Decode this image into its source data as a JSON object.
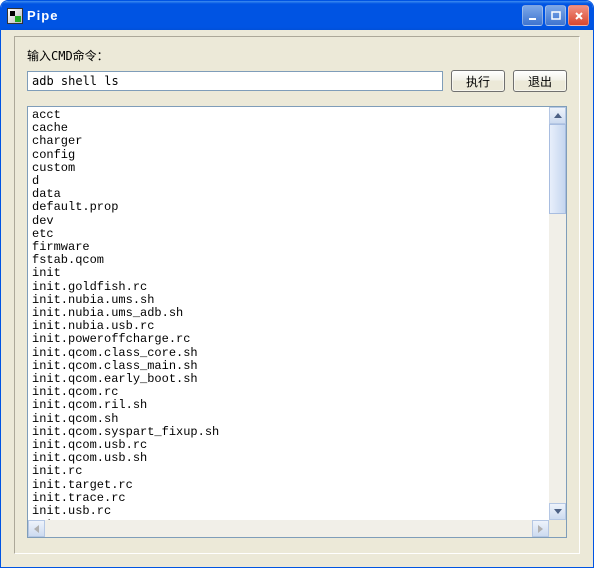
{
  "window": {
    "title": "Pipe"
  },
  "form": {
    "label": "输入CMD命令：",
    "command_value": "adb shell ls",
    "execute_label": "执行",
    "exit_label": "退出"
  },
  "output_lines": [
    "acct",
    "cache",
    "charger",
    "config",
    "custom",
    "d",
    "data",
    "default.prop",
    "dev",
    "etc",
    "firmware",
    "fstab.qcom",
    "init",
    "init.goldfish.rc",
    "init.nubia.ums.sh",
    "init.nubia.ums_adb.sh",
    "init.nubia.usb.rc",
    "init.poweroffcharge.rc",
    "init.qcom.class_core.sh",
    "init.qcom.class_main.sh",
    "init.qcom.early_boot.sh",
    "init.qcom.rc",
    "init.qcom.ril.sh",
    "init.qcom.sh",
    "init.qcom.syspart_fixup.sh",
    "init.qcom.usb.rc",
    "init.qcom.usb.sh",
    "init.rc",
    "init.target.rc",
    "init.trace.rc",
    "init.usb.rc",
    "mnt"
  ]
}
